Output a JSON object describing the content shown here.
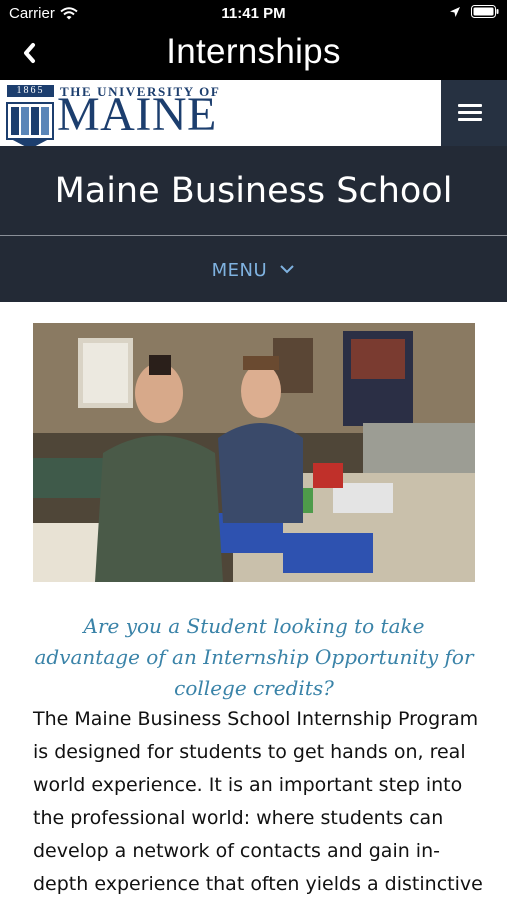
{
  "status": {
    "carrier": "Carrier",
    "time": "11:41 PM"
  },
  "nav": {
    "title": "Internships"
  },
  "logo": {
    "year": "1865",
    "line1": "THE UNIVERSITY OF",
    "line2": "MAINE"
  },
  "header": {
    "school_name": "Maine Business School",
    "menu_label": "MENU"
  },
  "content": {
    "tagline": "Are you a Student looking to take advantage of an Internship Opportunity for college credits?",
    "paragraph": "The Maine Business School Internship Program is designed for students to get hands on, real world experience.  It is an important step into the professional world: where students can develop a network of contacts and gain in-depth experience that often yields a distinctive"
  },
  "colors": {
    "brand_navy": "#1c3e6e",
    "header_bg": "#232a36",
    "menu_blue": "#7fb2e0",
    "tagline_blue": "#3a83a8"
  }
}
